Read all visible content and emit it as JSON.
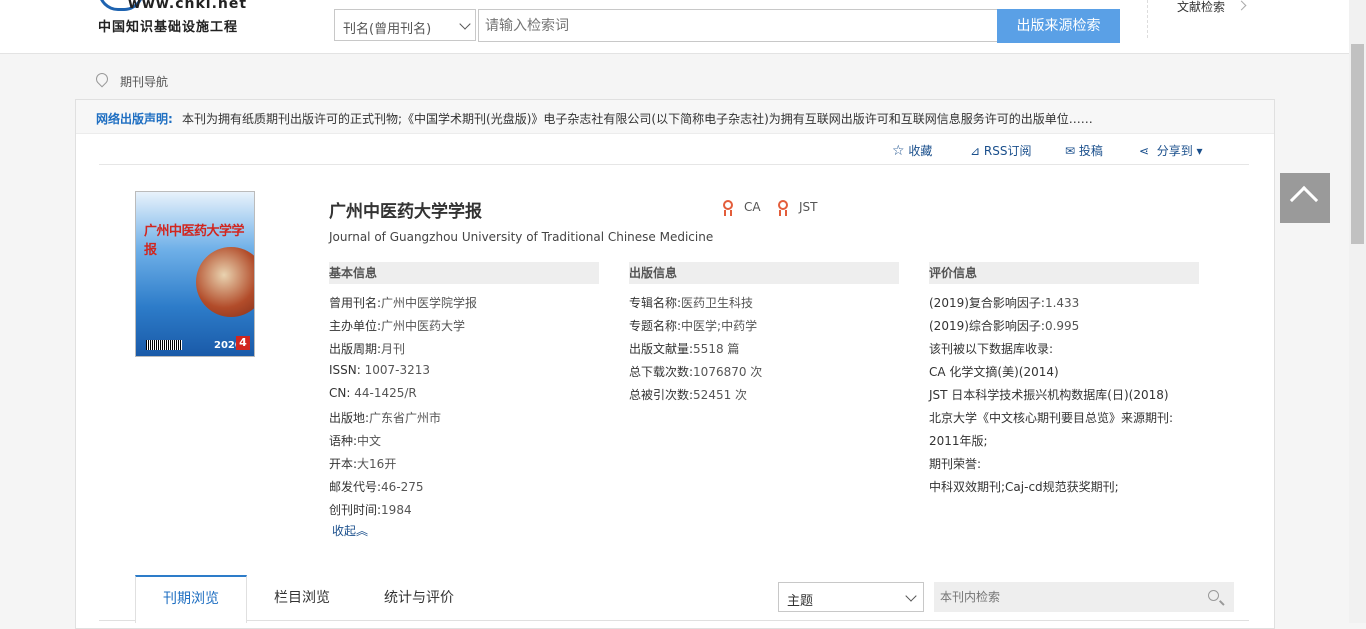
{
  "header": {
    "logo_url": "www.cnki.net",
    "logo_cn": "中国知识基础设施工程",
    "search_type": "刊名(曾用刊名)",
    "search_placeholder": "请输入检索词",
    "search_button": "出版来源检索",
    "right_link": "文献检索"
  },
  "breadcrumb": "期刊导航",
  "notice": {
    "title": "网络出版声明:",
    "text": "本刊为拥有纸质期刊出版许可的正式刊物;《中国学术期刊(光盘版)》电子杂志社有限公司(以下简称电子杂志社)为拥有互联网出版许可和互联网信息服务许可的出版单位……"
  },
  "actions": {
    "favorite": "收藏",
    "rss": "RSS订阅",
    "submit": "投稿",
    "share": "分享到 ▾"
  },
  "cover": {
    "title": "广州中医药大学学报",
    "year": "2020",
    "issue": "4"
  },
  "journal": {
    "title": "广州中医药大学学报",
    "english": "Journal of Guangzhou University of Traditional Chinese Medicine",
    "badges": [
      "CA",
      "JST"
    ]
  },
  "basic": {
    "head": "基本信息",
    "rows": [
      {
        "k": "曾用刊名:",
        "v": "广州中医学院学报"
      },
      {
        "k": "主办单位:",
        "v": "广州中医药大学"
      },
      {
        "k": "出版周期:",
        "v": "月刊"
      },
      {
        "k": "ISSN:",
        "v": "1007-3213"
      },
      {
        "k": "CN:",
        "v": "44-1425/R"
      },
      {
        "k": "出版地:",
        "v": "广东省广州市"
      },
      {
        "k": "语种:",
        "v": "中文"
      },
      {
        "k": "开本:",
        "v": "大16开"
      },
      {
        "k": "邮发代号:",
        "v": "46-275"
      },
      {
        "k": "创刊时间:",
        "v": "1984"
      }
    ],
    "collapse": "收起︽"
  },
  "publish": {
    "head": "出版信息",
    "rows": [
      {
        "k": "专辑名称:",
        "v": "医药卫生科技"
      },
      {
        "k": "专题名称:",
        "v": "中医学;中药学"
      },
      {
        "k": "出版文献量:",
        "v": "5518 篇"
      },
      {
        "k": "总下载次数:",
        "v": "1076870 次"
      },
      {
        "k": "总被引次数:",
        "v": "52451 次"
      }
    ]
  },
  "evaluation": {
    "head": "评价信息",
    "lines": [
      "(2019)复合影响因子:",
      "1.433",
      "(2019)综合影响因子:",
      "0.995",
      "该刊被以下数据库收录:",
      "CA 化学文摘(美)(2014)",
      "JST 日本科学技术振兴机构数据库(日)(2018)",
      "北京大学《中文核心期刊要目总览》来源期刊:",
      "2011年版;",
      "期刊荣誉:",
      "中科双效期刊;Caj-cd规范获奖期刊;"
    ]
  },
  "tabs": [
    "刊期浏览",
    "栏目浏览",
    "统计与评价"
  ],
  "filter": {
    "select": "主题",
    "search_placeholder": "本刊内检索"
  },
  "colors": {
    "accent": "#1f6fc2",
    "button": "#5aa0e6",
    "badge": "#e35d3b"
  }
}
